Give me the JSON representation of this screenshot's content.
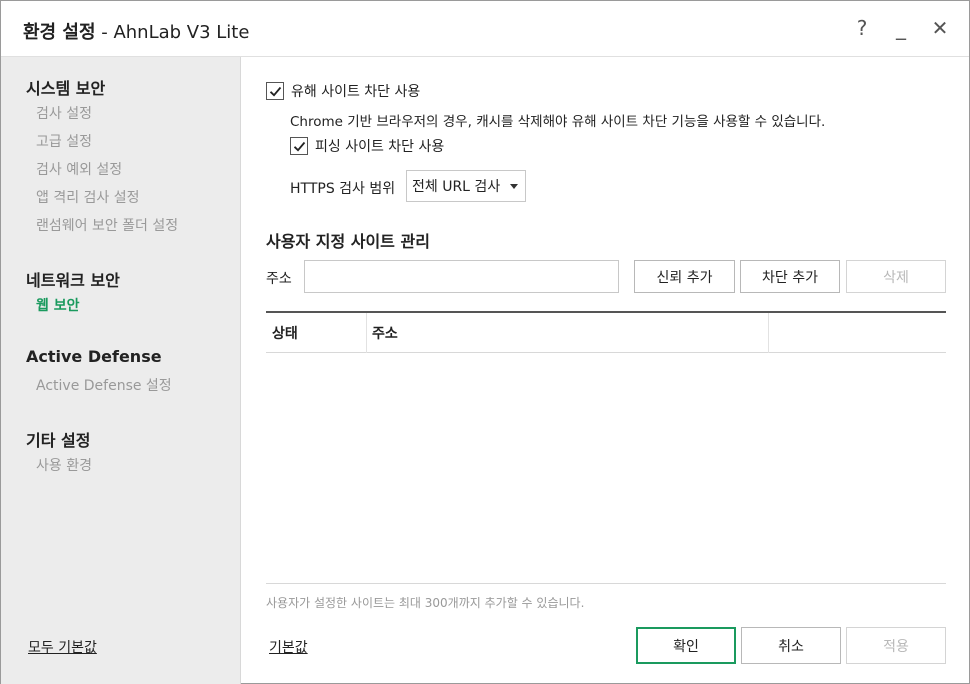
{
  "window": {
    "title_bold": "환경 설정",
    "title_rest": " - AhnLab V3 Lite",
    "help_label": "?",
    "minimize_label": "_",
    "close_label": "✕"
  },
  "sidebar": {
    "groups": [
      {
        "title": "시스템 보안",
        "items": [
          "검사 설정",
          "고급 설정",
          "검사 예외 설정",
          "앱 격리 검사 설정",
          "랜섬웨어 보안 폴더 설정"
        ]
      },
      {
        "title": "네트워크 보안",
        "items": [
          "웹 보안"
        ]
      },
      {
        "title": "Active Defense",
        "items": [
          "Active Defense 설정"
        ]
      },
      {
        "title": "기타 설정",
        "items": [
          "사용 환경"
        ]
      }
    ],
    "active_item": "웹 보안",
    "reset_all_label": "모두 기본값"
  },
  "main": {
    "harmful_site_block": {
      "label": "유해 사이트 차단 사용",
      "checked": true
    },
    "chrome_note": "Chrome 기반 브라우저의 경우, 캐시를 삭제해야 유해 사이트 차단 기능을 사용할 수 있습니다.",
    "phishing_block": {
      "label": "피싱 사이트 차단 사용",
      "checked": true
    },
    "https_scope": {
      "label": "HTTPS 검사 범위",
      "value": "전체 URL 검사"
    },
    "custom_sites": {
      "title": "사용자 지정 사이트 관리",
      "address_label": "주소",
      "address_value": "",
      "trust_add_label": "신뢰 추가",
      "block_add_label": "차단 추가",
      "delete_label": "삭제",
      "columns": [
        "상태",
        "주소"
      ],
      "rows": [],
      "limit_note": "사용자가 설정한 사이트는 최대 300개까지 추가할 수 있습니다."
    },
    "footer": {
      "reset_label": "기본값",
      "ok_label": "확인",
      "cancel_label": "취소",
      "apply_label": "적용"
    }
  },
  "colors": {
    "accent": "#1a9a5e",
    "sidebar_bg": "#ececec",
    "disabled_text": "#b8b8b8"
  }
}
